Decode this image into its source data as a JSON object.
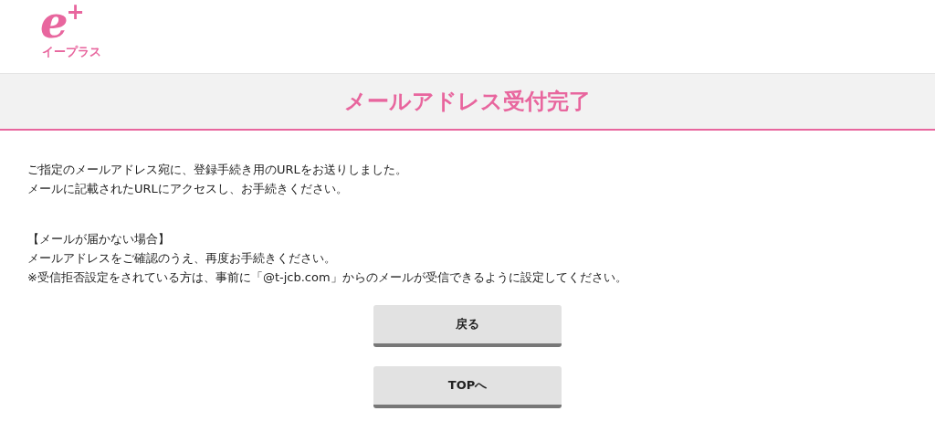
{
  "logo": {
    "mark": "e",
    "sup": "+",
    "caption": "イープラス"
  },
  "page_title": "メールアドレス受付完了",
  "paragraphs": [
    [
      "ご指定のメールアドレス宛に、登録手続き用のURLをお送りしました。",
      "メールに記載されたURLにアクセスし、お手続きください。"
    ],
    [
      "【メールが届かない場合】",
      "メールアドレスをご確認のうえ、再度お手続きください。",
      "※受信拒否設定をされている方は、事前に「@t-jcb.com」からのメールが受信できるように設定してください。"
    ]
  ],
  "buttons": [
    "戻る",
    "TOPへ"
  ]
}
